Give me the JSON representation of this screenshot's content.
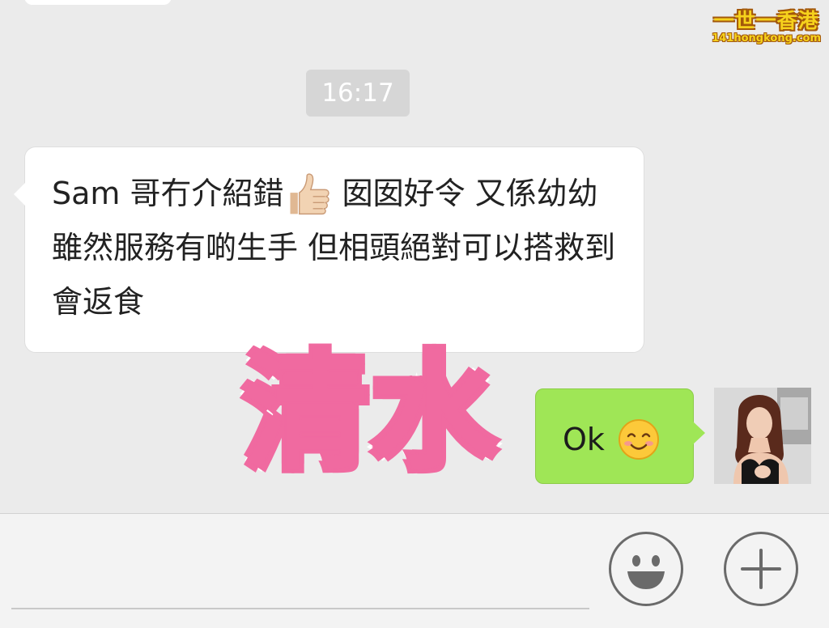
{
  "watermark": {
    "title": "一世一香港",
    "site": "141hongkong.com"
  },
  "timestamp": "16:17",
  "messages": [
    {
      "side": "incoming",
      "text_before_emoji": "Sam 哥冇介紹錯",
      "emoji": "thumbs-up-icon",
      "text_after_emoji": " 囡囡好令 又係幼幼 雖然服務有啲生手 但相頭絕對可以搭救到 會返食"
    },
    {
      "side": "outgoing",
      "text": "Ok",
      "emoji": "smiling-face-icon"
    }
  ],
  "overlay_caption": "清水",
  "colors": {
    "background": "#ebebeb",
    "incoming_bubble": "#ffffff",
    "outgoing_bubble": "#9fe656",
    "overlay_pink": "#f06aa0",
    "timestamp_bg": "#d6d6d6"
  },
  "input_bar": {
    "emoji_button_icon": "emoji-face-icon",
    "more_button_icon": "plus-icon"
  }
}
